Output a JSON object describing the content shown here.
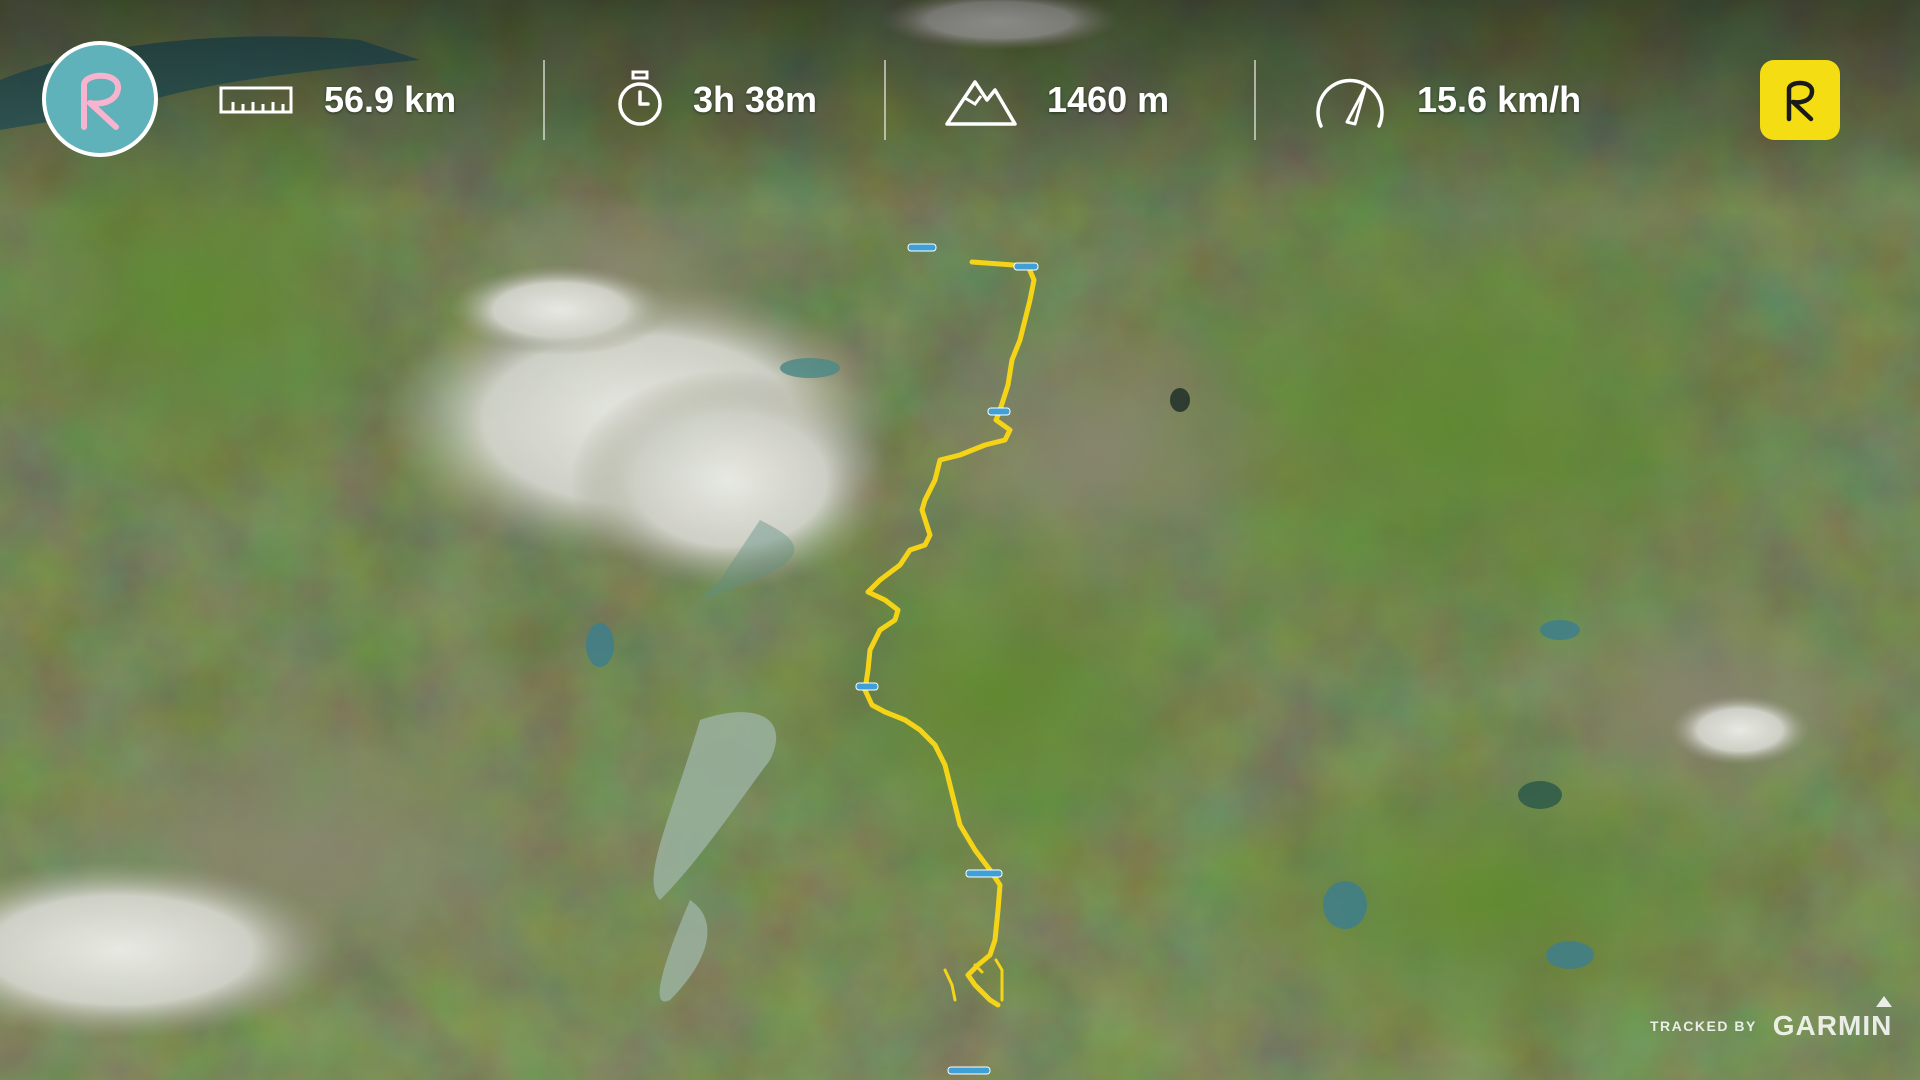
{
  "app": {
    "logo_icon": "relive-r-icon",
    "logo_color": "#5fb1ba",
    "brand_badge_icon": "relive-r-icon",
    "brand_badge_color": "#f4dd13"
  },
  "stats": {
    "distance": {
      "icon": "ruler-icon",
      "value": "56.9 km"
    },
    "duration": {
      "icon": "stopwatch-icon",
      "value": "3h 38m"
    },
    "elevation": {
      "icon": "mountain-icon",
      "value": "1460 m"
    },
    "speed": {
      "icon": "speedometer-icon",
      "value": "15.6 km/h"
    }
  },
  "map": {
    "type": "3D satellite terrain",
    "route_color": "#f5d417",
    "waypoint_color": "#3fa0d8"
  },
  "footer": {
    "tracked_by": "TRACKED BY",
    "brand": "GARMIN"
  }
}
